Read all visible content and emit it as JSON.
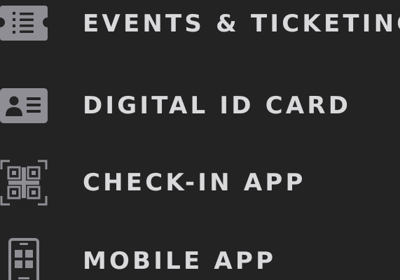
{
  "menu": {
    "items": [
      {
        "label": "EVENTS & TICKETING",
        "icon": "ticket-icon"
      },
      {
        "label": "DIGITAL ID CARD",
        "icon": "id-card-icon"
      },
      {
        "label": "CHECK-IN APP",
        "icon": "qr-code-icon"
      },
      {
        "label": "MOBILE APP",
        "icon": "mobile-app-icon"
      }
    ]
  },
  "colors": {
    "background": "#232324",
    "text": "#d9d9db",
    "icon": "#8e8e94"
  }
}
